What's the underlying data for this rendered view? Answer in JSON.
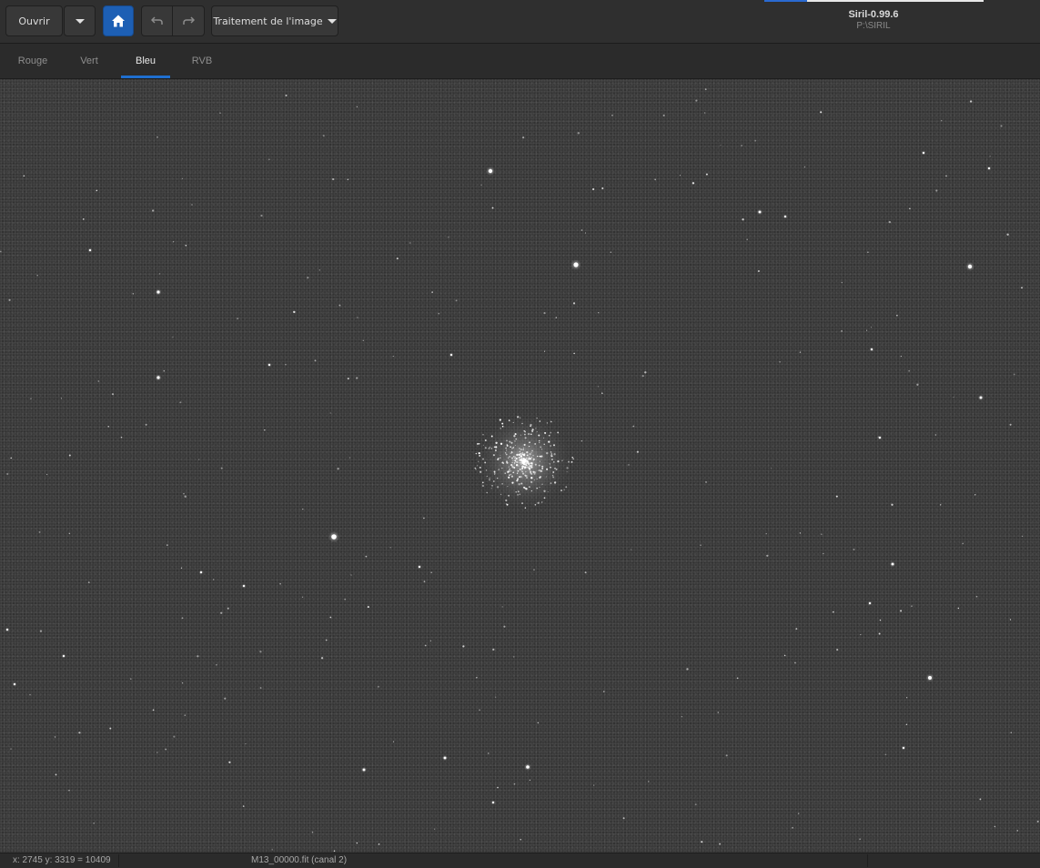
{
  "toolbar": {
    "open_label": "Ouvrir",
    "processing_label": "Traitement de l'image"
  },
  "window": {
    "title": "Siril-0.99.6",
    "subtitle": "P:\\SIRIL"
  },
  "tabs": [
    {
      "label": "Rouge",
      "active": false
    },
    {
      "label": "Vert",
      "active": false
    },
    {
      "label": "Bleu",
      "active": true
    },
    {
      "label": "RVB",
      "active": false
    }
  ],
  "image": {
    "content": "M13 globular cluster star field"
  },
  "status": {
    "coords": "x: 2745 y: 3319 = 10409",
    "file": "M13_00000.fit (canal 2)"
  },
  "colors": {
    "accent": "#1f6fd0",
    "home_button": "#1d5fb4",
    "image_background": "#3a3a3a"
  }
}
